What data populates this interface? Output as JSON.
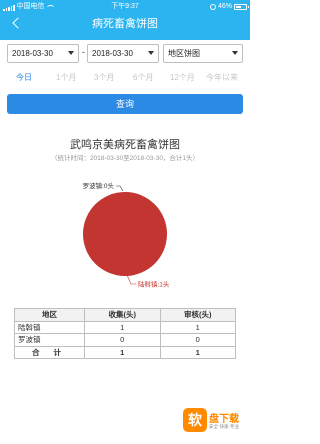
{
  "status_bar": {
    "carrier": "中国电信",
    "time": "下午9:37",
    "battery": "46%"
  },
  "header": {
    "title": "病死畜禽饼图"
  },
  "filters": {
    "start_date": "2018-03-30",
    "end_date": "2018-03-30",
    "separator": "-",
    "chart_type": "地区饼图"
  },
  "quick_ranges": [
    {
      "label": "今日",
      "active": true
    },
    {
      "label": "1个月",
      "active": false
    },
    {
      "label": "3个月",
      "active": false
    },
    {
      "label": "6个月",
      "active": false
    },
    {
      "label": "12个月",
      "active": false
    },
    {
      "label": "今年以来",
      "active": false
    }
  ],
  "query_button": "查询",
  "chart_data": {
    "type": "pie",
    "title": "武鸣京美病死畜禽饼图",
    "subtitle": "（统计时间：2018-03-30至2018-03-30，合计1头）",
    "slices": [
      {
        "label": "罗波镇:0头",
        "name": "罗波镇",
        "value": 0,
        "color": "#c23531"
      },
      {
        "label": "陆斡镇:1头",
        "name": "陆斡镇",
        "value": 1,
        "color": "#c23531"
      }
    ]
  },
  "table": {
    "headers": [
      "地区",
      "收集(头)",
      "审核(头)"
    ],
    "rows": [
      [
        "陆斡镇",
        "1",
        "1"
      ],
      [
        "罗波镇",
        "0",
        "0"
      ]
    ],
    "total": [
      "合 计",
      "1",
      "1"
    ]
  },
  "watermark": {
    "logo_char": "软",
    "name": "盘下载",
    "slogan": "安全·快速·专业"
  }
}
